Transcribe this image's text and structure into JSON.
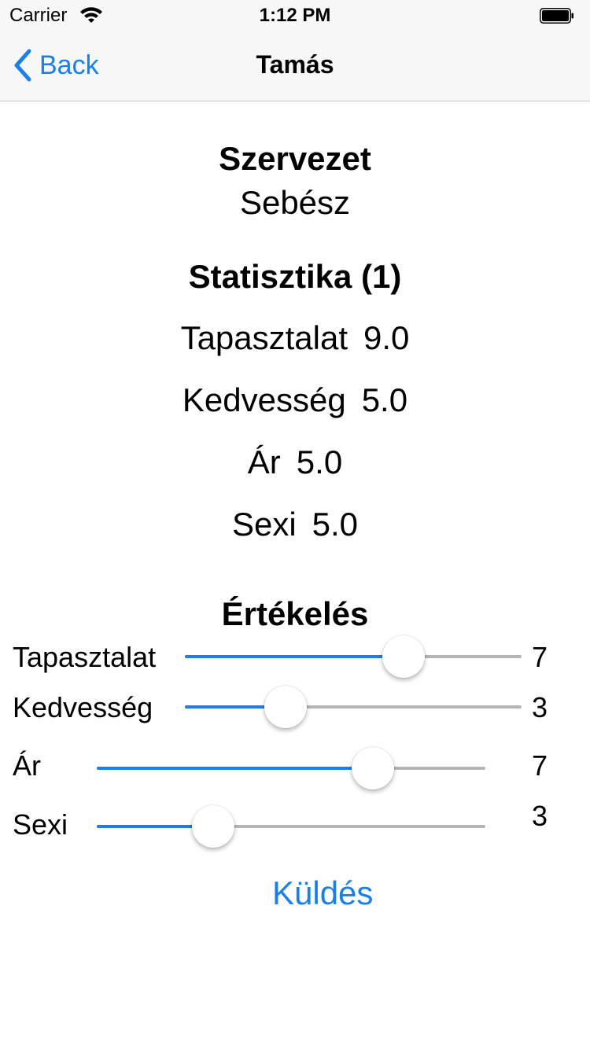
{
  "status_bar": {
    "carrier": "Carrier",
    "time": "1:12 PM",
    "wifi_icon": "wifi-icon",
    "battery_icon": "battery-icon"
  },
  "nav": {
    "back_label": "Back",
    "back_icon": "chevron-left-icon",
    "title": "Tamás"
  },
  "profile": {
    "org_heading": "Szervezet",
    "org_value": "Sebész",
    "stats_heading": "Statisztika (1)",
    "stats": [
      {
        "label": "Tapasztalat",
        "value": "9.0"
      },
      {
        "label": "Kedvesség",
        "value": "5.0"
      },
      {
        "label": "Ár",
        "value": "5.0"
      },
      {
        "label": "Sexi",
        "value": "5.0"
      }
    ]
  },
  "rating": {
    "heading": "Értékelés",
    "sliders": [
      {
        "label": "Tapasztalat",
        "value": "7",
        "fraction": 0.65
      },
      {
        "label": "Kedvesség",
        "value": "3",
        "fraction": 0.3
      },
      {
        "label": "Ár",
        "value": "7",
        "fraction": 0.71
      },
      {
        "label": "Sexi",
        "value": "3",
        "fraction": 0.3
      }
    ],
    "submit_label": "Küldés"
  },
  "colors": {
    "accent": "#1a7fe8",
    "track": "#b5b5b5",
    "bar_background": "#f7f7f7"
  }
}
